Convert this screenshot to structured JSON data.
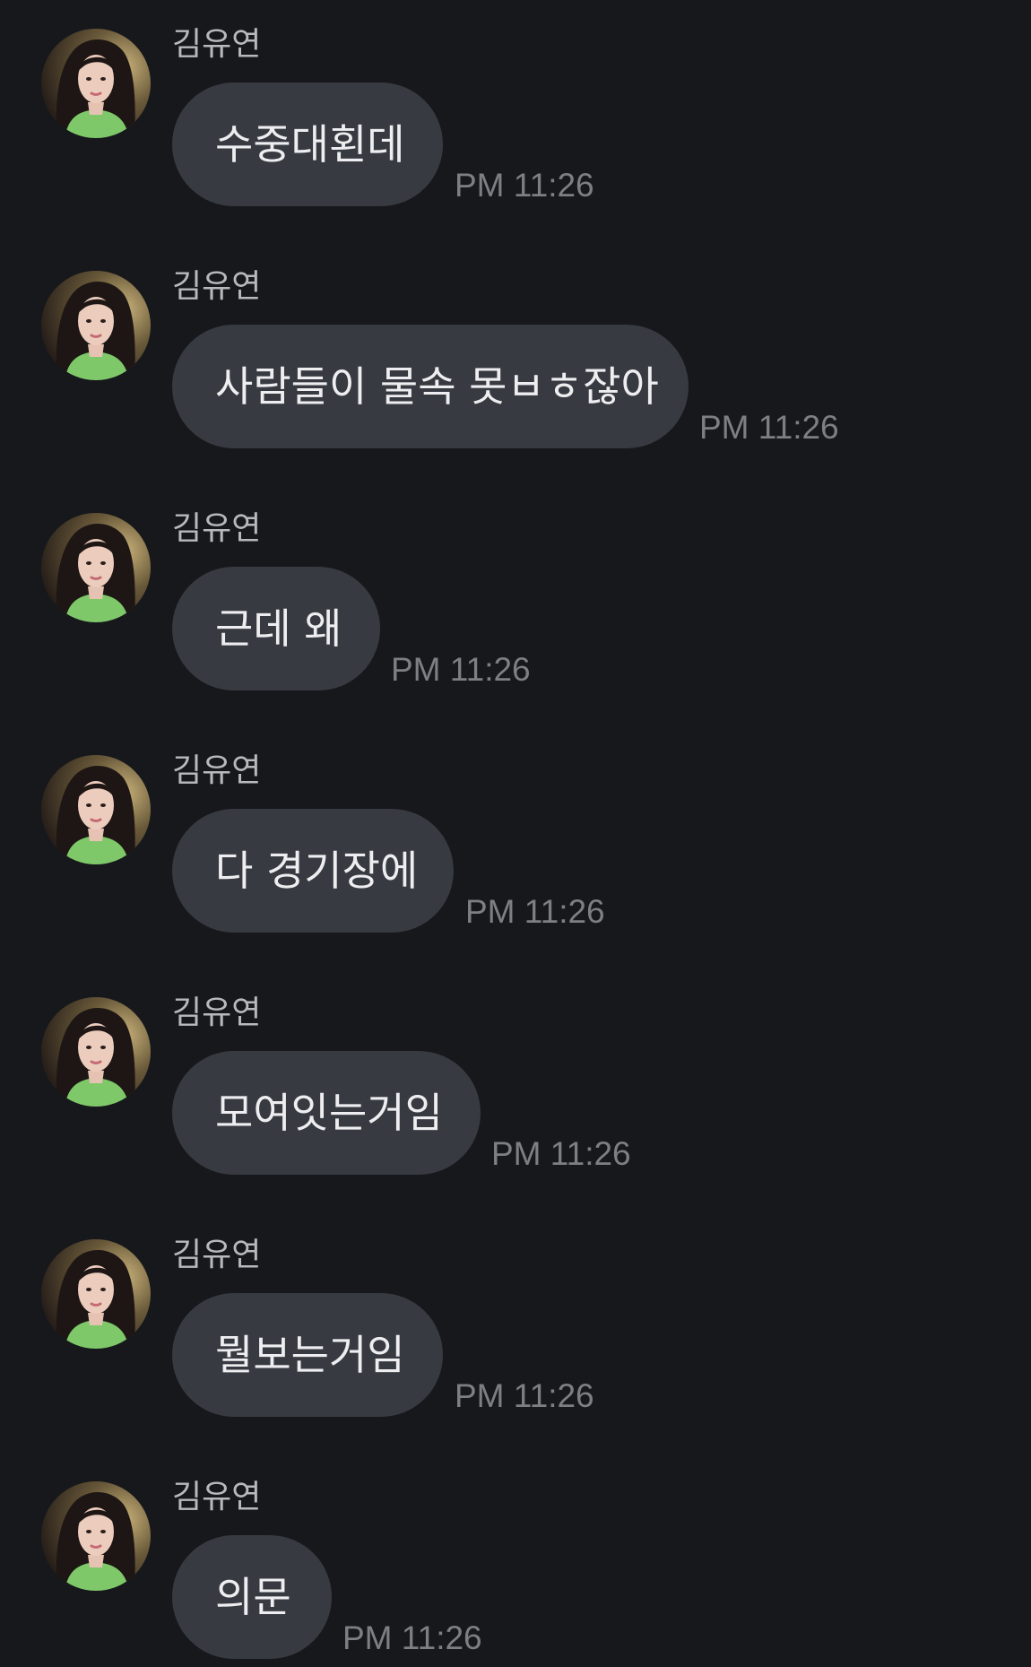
{
  "messages": [
    {
      "sender": "김유연",
      "text": "수중대횐데",
      "time": "PM 11:26"
    },
    {
      "sender": "김유연",
      "text": "사람들이 물속 못ㅂㅎ잖아",
      "time": "PM 11:26"
    },
    {
      "sender": "김유연",
      "text": "근데 왜",
      "time": "PM 11:26"
    },
    {
      "sender": "김유연",
      "text": "다 경기장에",
      "time": "PM 11:26"
    },
    {
      "sender": "김유연",
      "text": "모여잇는거임",
      "time": "PM 11:26"
    },
    {
      "sender": "김유연",
      "text": "뭘보는거임",
      "time": "PM 11:26"
    },
    {
      "sender": "김유연",
      "text": "의문",
      "time": "PM 11:26"
    }
  ],
  "theme": {
    "background": "#17181c",
    "bubble": "#373a41",
    "bubble_text": "#eeeef0",
    "sender_text": "#b8b9be",
    "time_text": "#7d7f85"
  },
  "avatar_icon": "profile-photo"
}
